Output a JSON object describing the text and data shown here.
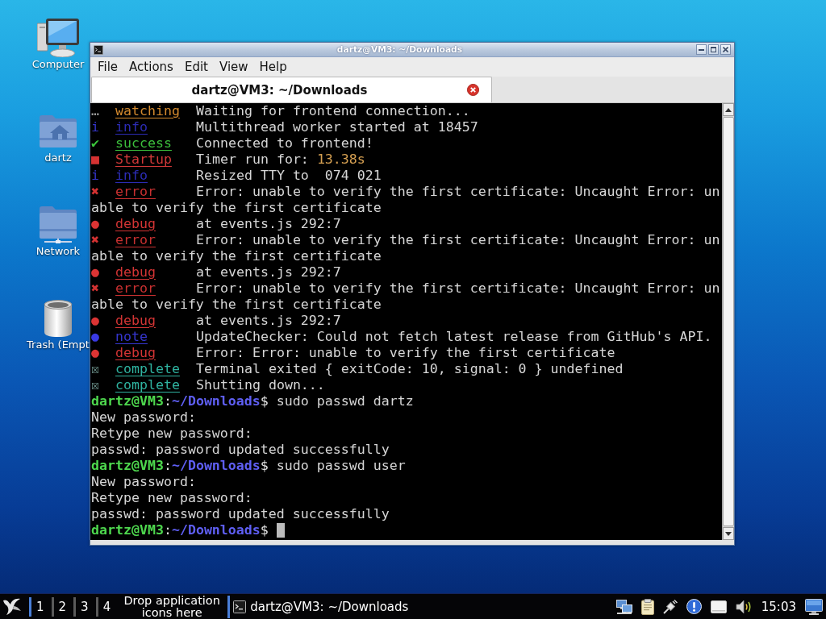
{
  "desktop": {
    "icons": [
      {
        "kind": "computer",
        "label": "Computer"
      },
      {
        "kind": "home",
        "label": "dartz"
      },
      {
        "kind": "network",
        "label": "Network"
      },
      {
        "kind": "trash",
        "label": "Trash (Empt"
      }
    ]
  },
  "window": {
    "title": "dartz@VM3: ~/Downloads",
    "menu": [
      "File",
      "Actions",
      "Edit",
      "View",
      "Help"
    ],
    "tabs": [
      {
        "title": "dartz@VM3: ~/Downloads",
        "selected": true
      }
    ],
    "terminal": {
      "lines": [
        {
          "kind": "watching",
          "symbol": "…",
          "tag": "watching",
          "color": "#d48a2e",
          "message": "Waiting for frontend connection..."
        },
        {
          "kind": "info",
          "symbol": "i",
          "tag": "info",
          "color": "#2c2cb4",
          "message": "Multithread worker started at 18457"
        },
        {
          "kind": "success",
          "symbol": "✔",
          "tag": "success",
          "color": "#3cbf3c",
          "message": "Connected to frontend!"
        },
        {
          "kind": "startup",
          "symbol": "■",
          "tag": "Startup",
          "color": "#d03838",
          "message": "Timer run for:",
          "value": "13.38s"
        },
        {
          "kind": "info",
          "symbol": "i",
          "tag": "info",
          "color": "#2c2cb4",
          "message": "Resized TTY to  074 021"
        },
        {
          "kind": "error",
          "symbol": "✖",
          "tag": "error",
          "color": "#c83030",
          "message": "Error: unable to verify the first certificate: Uncaught Error: un"
        },
        {
          "kind": "text",
          "text": "able to verify the first certificate"
        },
        {
          "kind": "debug",
          "symbol": "●",
          "tag": "debug",
          "color": "#d23434",
          "message": "at events.js 292:7"
        },
        {
          "kind": "error",
          "symbol": "✖",
          "tag": "error",
          "color": "#c83030",
          "message": "Error: unable to verify the first certificate: Uncaught Error: un"
        },
        {
          "kind": "text",
          "text": "able to verify the first certificate"
        },
        {
          "kind": "debug",
          "symbol": "●",
          "tag": "debug",
          "color": "#d23434",
          "message": "at events.js 292:7"
        },
        {
          "kind": "error",
          "symbol": "✖",
          "tag": "error",
          "color": "#c83030",
          "message": "Error: unable to verify the first certificate: Uncaught Error: un"
        },
        {
          "kind": "text",
          "text": "able to verify the first certificate"
        },
        {
          "kind": "debug",
          "symbol": "●",
          "tag": "debug",
          "color": "#d23434",
          "message": "at events.js 292:7"
        },
        {
          "kind": "note",
          "symbol": "●",
          "tag": "note",
          "color": "#3636d0",
          "message": "UpdateChecker: Could not fetch latest release from GitHub's API."
        },
        {
          "kind": "debug",
          "symbol": "●",
          "tag": "debug",
          "color": "#d23434",
          "message": "Error: Error: unable to verify the first certificate"
        },
        {
          "kind": "complete",
          "symbol": "☒",
          "tag": "complete",
          "color": "#2fb3a0",
          "message": "Terminal exited { exitCode: 10, signal: 0 } undefined"
        },
        {
          "kind": "complete",
          "symbol": "☒",
          "tag": "complete",
          "color": "#2fb3a0",
          "message": "Shutting down..."
        },
        {
          "kind": "prompt",
          "user_host": "dartz@VM3",
          "separator": ":",
          "path": "~/Downloads",
          "prompt_char": "$",
          "command": "sudo passwd dartz",
          "cursor": false
        },
        {
          "kind": "text",
          "text": "New password:"
        },
        {
          "kind": "text",
          "text": "Retype new password:"
        },
        {
          "kind": "text",
          "text": "passwd: password updated successfully"
        },
        {
          "kind": "prompt",
          "user_host": "dartz@VM3",
          "separator": ":",
          "path": "~/Downloads",
          "prompt_char": "$",
          "command": "sudo passwd user",
          "cursor": false
        },
        {
          "kind": "text",
          "text": "New password:"
        },
        {
          "kind": "text",
          "text": "Retype new password:"
        },
        {
          "kind": "text",
          "text": "passwd: password updated successfully"
        },
        {
          "kind": "prompt",
          "user_host": "dartz@VM3",
          "separator": ":",
          "path": "~/Downloads",
          "prompt_char": "$",
          "cursor": true
        }
      ]
    }
  },
  "taskbar": {
    "workspaces": [
      {
        "label": "1",
        "selected": true
      },
      {
        "label": "2",
        "selected": false
      },
      {
        "label": "3",
        "selected": false
      },
      {
        "label": "4",
        "selected": false
      }
    ],
    "launcher_hint": "Drop application icons here",
    "tasks": [
      {
        "title": "dartz@VM3: ~/Downloads"
      }
    ],
    "clock": "15:03"
  }
}
